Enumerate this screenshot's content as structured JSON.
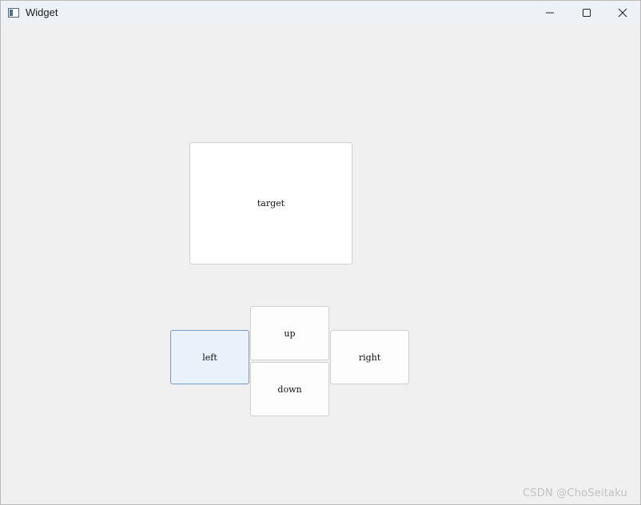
{
  "window": {
    "title": "Widget"
  },
  "buttons": {
    "target": "target",
    "up": "up",
    "down": "down",
    "left": "left",
    "right": "right"
  },
  "watermark": "CSDN @ChoSeitaku",
  "icons": {
    "app": "window-app-icon",
    "minimize": "minimize-icon",
    "maximize": "maximize-icon",
    "close": "close-icon"
  },
  "colors": {
    "focused_button_bg": "#e9f1fb",
    "focused_button_border": "#6d9bd0"
  }
}
